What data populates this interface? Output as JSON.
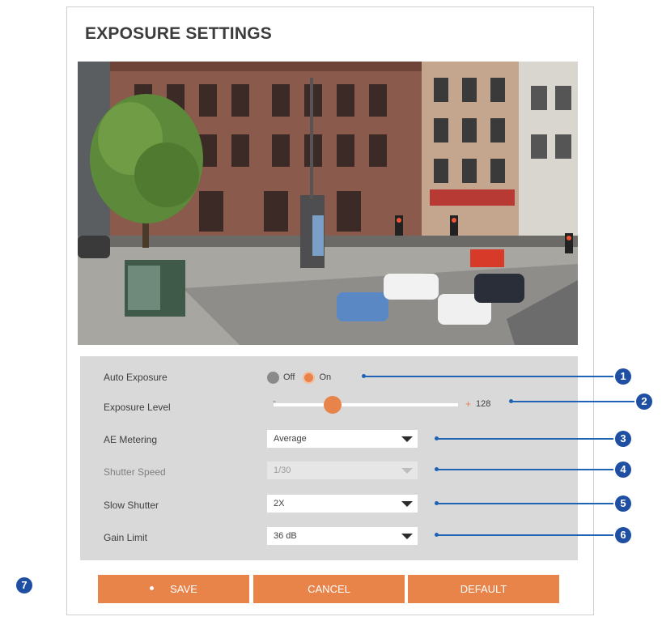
{
  "title": "EXPOSURE SETTINGS",
  "settings": {
    "auto_exposure": {
      "label": "Auto Exposure",
      "off_label": "Off",
      "on_label": "On",
      "selected": "On"
    },
    "exposure_level": {
      "label": "Exposure Level",
      "minus": "-",
      "plus": "+",
      "value": "128",
      "fraction": 0.32
    },
    "ae_metering": {
      "label": "AE Metering",
      "value": "Average"
    },
    "shutter_speed": {
      "label": "Shutter Speed",
      "value": "1/30"
    },
    "slow_shutter": {
      "label": "Slow Shutter",
      "value": "2X"
    },
    "gain_limit": {
      "label": "Gain Limit",
      "value": "36 dB"
    }
  },
  "callouts": [
    "1",
    "2",
    "3",
    "4",
    "5",
    "6",
    "7"
  ],
  "buttons": {
    "save": "SAVE",
    "cancel": "CANCEL",
    "default": "DEFAULT"
  },
  "colors": {
    "accent": "#e8834a",
    "callout": "#1f4fa3",
    "panel_bg": "#d9d9d9"
  }
}
